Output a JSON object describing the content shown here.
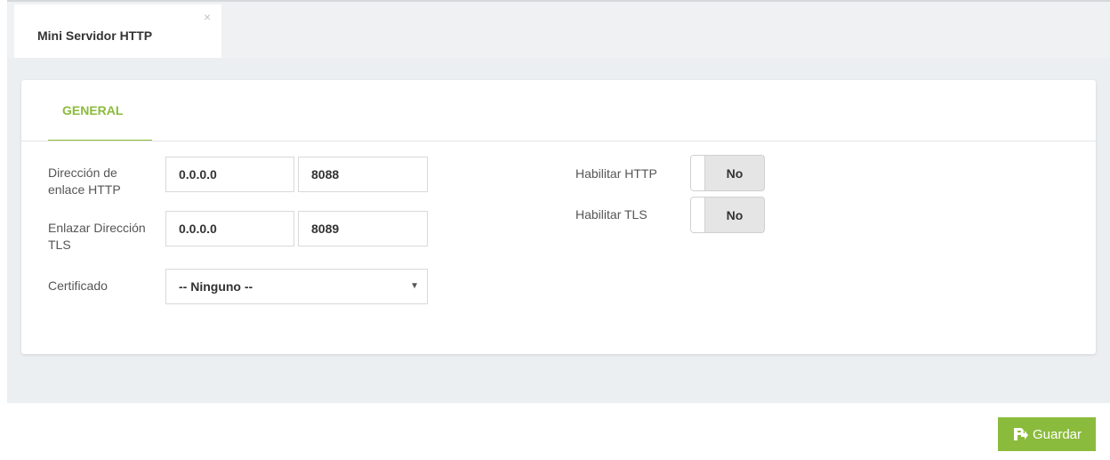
{
  "tab": {
    "title": "Mini Servidor HTTP",
    "close_glyph": "×"
  },
  "panel": {
    "tab_label": "GENERAL"
  },
  "form": {
    "http_bind_label": "Dirección de enlace HTTP",
    "http_bind_ip": "0.0.0.0",
    "http_bind_port": "8088",
    "tls_bind_label": "Enlazar Dirección TLS",
    "tls_bind_ip": "0.0.0.0",
    "tls_bind_port": "8089",
    "certificate_label": "Certificado",
    "certificate_value": "-- Ninguno --",
    "enable_http_label": "Habilitar HTTP",
    "enable_http_value": "No",
    "enable_tls_label": "Habilitar TLS",
    "enable_tls_value": "No"
  },
  "footer": {
    "save_label": "Guardar"
  },
  "colors": {
    "accent": "#8bbb3c"
  },
  "icons": {
    "save": "save-arrow-icon",
    "dropdown": "caret-down-icon",
    "close": "close-icon"
  }
}
